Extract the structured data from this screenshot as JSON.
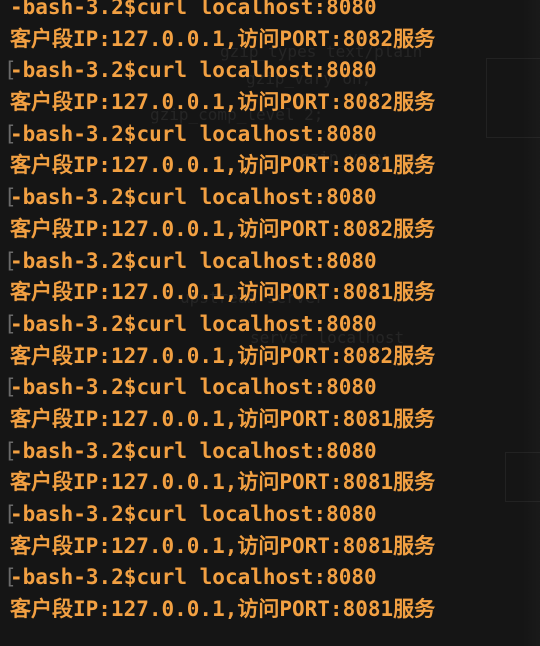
{
  "terminal": {
    "lines": [
      {
        "kind": "prompt",
        "prompt": "-bash-3.2$",
        "command": "curl localhost:8080",
        "bracket": ""
      },
      {
        "kind": "output",
        "text": "客户段IP:127.0.0.1,访问PORT:8082服务"
      },
      {
        "kind": "prompt",
        "prompt": "-bash-3.2$",
        "command": "curl localhost:8080",
        "bracket": "["
      },
      {
        "kind": "output",
        "text": "客户段IP:127.0.0.1,访问PORT:8082服务"
      },
      {
        "kind": "prompt",
        "prompt": "-bash-3.2$",
        "command": "curl localhost:8080",
        "bracket": "["
      },
      {
        "kind": "output",
        "text": "客户段IP:127.0.0.1,访问PORT:8081服务"
      },
      {
        "kind": "prompt",
        "prompt": "-bash-3.2$",
        "command": "curl localhost:8080",
        "bracket": "["
      },
      {
        "kind": "output",
        "text": "客户段IP:127.0.0.1,访问PORT:8082服务"
      },
      {
        "kind": "prompt",
        "prompt": "-bash-3.2$",
        "command": "curl localhost:8080",
        "bracket": "["
      },
      {
        "kind": "output",
        "text": "客户段IP:127.0.0.1,访问PORT:8081服务"
      },
      {
        "kind": "prompt",
        "prompt": "-bash-3.2$",
        "command": "curl localhost:8080",
        "bracket": "["
      },
      {
        "kind": "output",
        "text": "客户段IP:127.0.0.1,访问PORT:8082服务"
      },
      {
        "kind": "prompt",
        "prompt": "-bash-3.2$",
        "command": "curl localhost:8080",
        "bracket": "["
      },
      {
        "kind": "output",
        "text": "客户段IP:127.0.0.1,访问PORT:8081服务"
      },
      {
        "kind": "prompt",
        "prompt": "-bash-3.2$",
        "command": "curl localhost:8080",
        "bracket": "["
      },
      {
        "kind": "output",
        "text": "客户段IP:127.0.0.1,访问PORT:8081服务"
      },
      {
        "kind": "prompt",
        "prompt": "-bash-3.2$",
        "command": "curl localhost:8080",
        "bracket": "["
      },
      {
        "kind": "output",
        "text": "客户段IP:127.0.0.1,访问PORT:8081服务"
      },
      {
        "kind": "prompt",
        "prompt": "-bash-3.2$",
        "command": "curl localhost:8080",
        "bracket": "["
      },
      {
        "kind": "output",
        "text": "客户段IP:127.0.0.1,访问PORT:8081服务"
      }
    ]
  },
  "colors": {
    "background": "#151515",
    "text": "#f2a042",
    "bracket": "#6a6a6a"
  }
}
